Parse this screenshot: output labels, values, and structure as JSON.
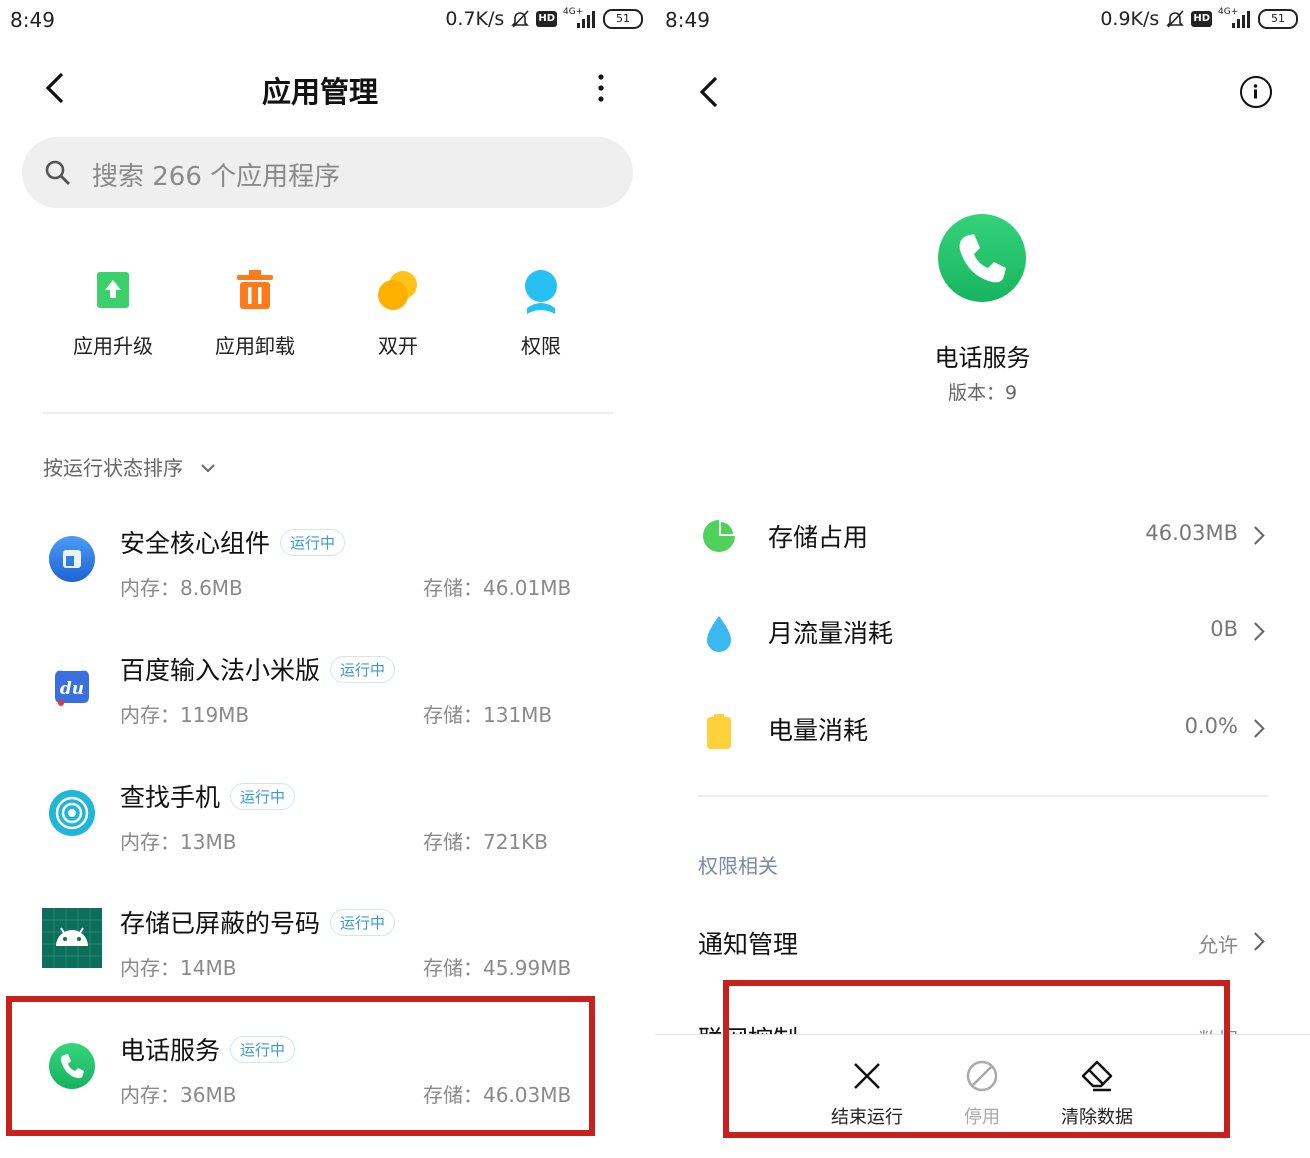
{
  "left": {
    "status": {
      "time": "8:49",
      "speed": "0.7K/s",
      "network": "4G+",
      "battery": "51"
    },
    "title": "应用管理",
    "search_placeholder": "搜索 266 个应用程序",
    "quick_actions": [
      {
        "label": "应用升级",
        "icon": "upgrade-icon"
      },
      {
        "label": "应用卸载",
        "icon": "trash-icon"
      },
      {
        "label": "双开",
        "icon": "dual-app-icon"
      },
      {
        "label": "权限",
        "icon": "permission-icon"
      }
    ],
    "sort_label": "按运行状态排序",
    "apps": [
      {
        "name": "安全核心组件",
        "status": "运行中",
        "memory": "内存：8.6MB",
        "storage": "存储：46.01MB",
        "icon": "security-core-icon",
        "color": "#2f7ee0"
      },
      {
        "name": "百度输入法小米版",
        "status": "运行中",
        "memory": "内存：119MB",
        "storage": "存储：131MB",
        "icon": "baidu-input-icon",
        "color": "#3a6fe0"
      },
      {
        "name": "查找手机",
        "status": "运行中",
        "memory": "内存：13MB",
        "storage": "存储：721KB",
        "icon": "find-phone-icon",
        "color": "#22b8d9"
      },
      {
        "name": "存储已屏蔽的号码",
        "status": "运行中",
        "memory": "内存：14MB",
        "storage": "存储：45.99MB",
        "icon": "android-icon",
        "color": "#0d6e5a"
      },
      {
        "name": "电话服务",
        "status": "运行中",
        "memory": "内存：36MB",
        "storage": "存储：46.03MB",
        "icon": "phone-icon",
        "color": "#22c56b"
      }
    ]
  },
  "right": {
    "status": {
      "time": "8:49",
      "speed": "0.9K/s",
      "network": "4G+",
      "battery": "51"
    },
    "app_name": "电话服务",
    "version": "版本：9",
    "stats": [
      {
        "label": "存储占用",
        "value": "46.03MB",
        "icon": "pie-chart-icon",
        "color": "#4fd15a"
      },
      {
        "label": "月流量消耗",
        "value": "0B",
        "icon": "water-drop-icon",
        "color": "#3ab8f0"
      },
      {
        "label": "电量消耗",
        "value": "0.0%",
        "icon": "battery-icon",
        "color": "#ffd23b"
      }
    ],
    "section_label": "权限相关",
    "permissions": [
      {
        "label": "通知管理",
        "value": "允许"
      },
      {
        "label": "联网控制",
        "value": "数据"
      }
    ],
    "actions": [
      {
        "label": "结束运行",
        "icon": "close-icon",
        "enabled": true
      },
      {
        "label": "停用",
        "icon": "disable-icon",
        "enabled": false
      },
      {
        "label": "清除数据",
        "icon": "eraser-icon",
        "enabled": true
      }
    ]
  },
  "colors": {
    "highlight": "#c8201d",
    "accent": "#3a9ad9"
  }
}
